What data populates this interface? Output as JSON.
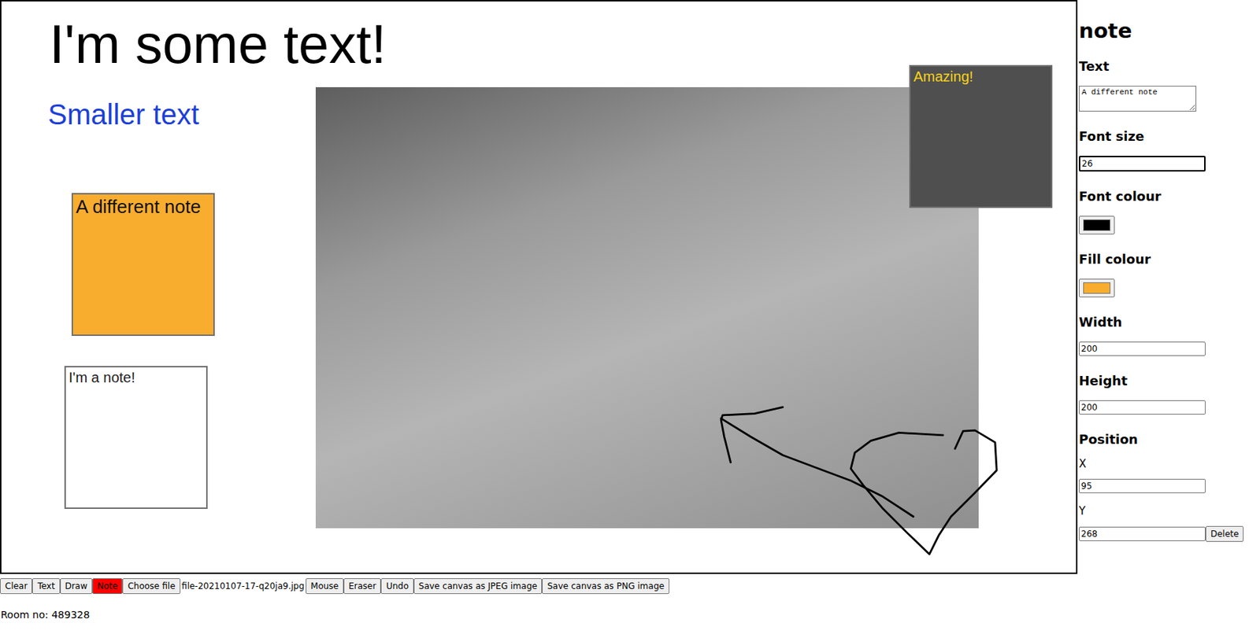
{
  "canvas": {
    "texts": [
      {
        "text": "I'm some text!",
        "size": "large",
        "color": "#000000"
      },
      {
        "text": "Smaller text",
        "size": "medium",
        "color": "#1c3fd8"
      }
    ],
    "notes": [
      {
        "text": "A different note",
        "fill": "#f9ad2e",
        "color": "#111111",
        "size": "large"
      },
      {
        "text": "I'm a note!",
        "fill": "#ffffff",
        "color": "#222222",
        "size": "small"
      },
      {
        "text": "Amazing!",
        "fill": "#4f4f4f",
        "color": "#f7d21a",
        "size": "small"
      }
    ]
  },
  "toolbar": [
    {
      "label": "Clear",
      "kind": "button",
      "selected": false
    },
    {
      "label": "Text",
      "kind": "button",
      "selected": false
    },
    {
      "label": "Draw",
      "kind": "button",
      "selected": false
    },
    {
      "label": "Note",
      "kind": "button",
      "selected": true
    },
    {
      "label": "Choose file",
      "kind": "file",
      "value": "file-20210107-17-q20ja9.jpg",
      "selected": false
    },
    {
      "label": "Mouse",
      "kind": "button",
      "selected": false
    },
    {
      "label": "Eraser",
      "kind": "button",
      "selected": false
    },
    {
      "label": "Undo",
      "kind": "button",
      "selected": false
    },
    {
      "label": "Save canvas as JPEG image",
      "kind": "button",
      "selected": false
    },
    {
      "label": "Save canvas as PNG image",
      "kind": "button",
      "selected": false
    }
  ],
  "room": "Room no: 489328",
  "panel": {
    "title": "note",
    "fields": [
      {
        "label": "Text",
        "kind": "textarea",
        "value": "A different note",
        "focused": false
      },
      {
        "label": "Font size",
        "kind": "number",
        "value": "26",
        "focused": true
      },
      {
        "label": "Font colour",
        "kind": "color",
        "color": "#000000"
      },
      {
        "label": "Fill colour",
        "kind": "color",
        "color": "#f9ad2e"
      },
      {
        "label": "Width",
        "kind": "text",
        "value": "200",
        "focused": false
      },
      {
        "label": "Height",
        "kind": "text",
        "value": "200",
        "focused": false
      },
      {
        "label": "Position",
        "kind": "heading"
      },
      {
        "label": "X",
        "kind": "sub",
        "value": "95",
        "focused": false
      },
      {
        "label": "Y",
        "kind": "sub",
        "value": "268",
        "focused": false,
        "action": "Delete"
      }
    ]
  }
}
